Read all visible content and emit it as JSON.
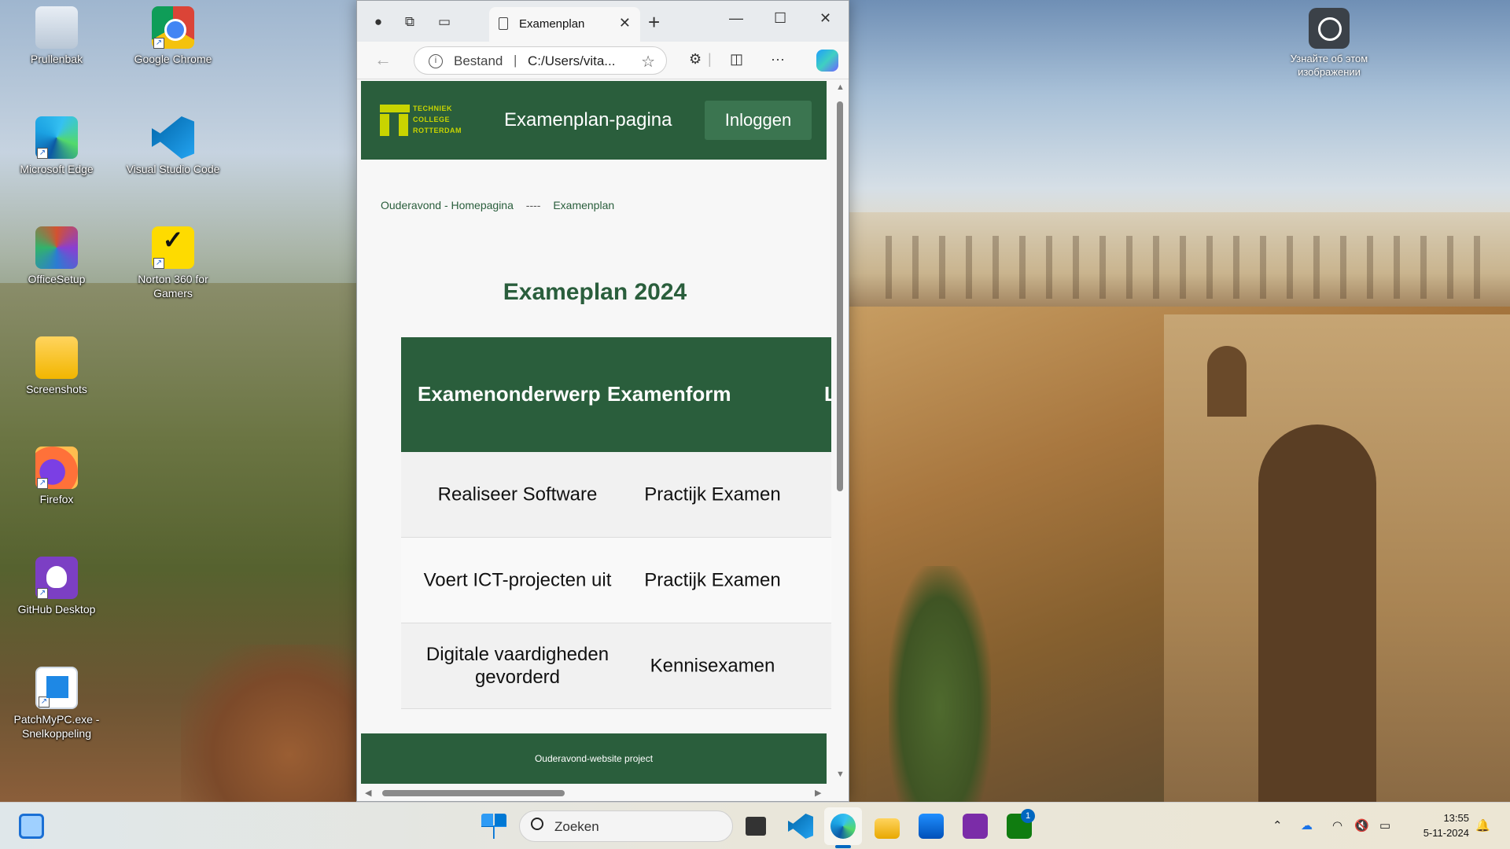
{
  "desktop": {
    "icons": [
      {
        "label": "Prullenbak"
      },
      {
        "label": "Google Chrome"
      },
      {
        "label": "Microsoft Edge"
      },
      {
        "label": "Visual Studio Code"
      },
      {
        "label": "OfficeSetup"
      },
      {
        "label": "Norton 360 for Gamers"
      },
      {
        "label": "Screenshots"
      },
      {
        "label": "Firefox"
      },
      {
        "label": "GitHub Desktop"
      },
      {
        "label": "PatchMyPC.exe - Snelkoppeling"
      }
    ],
    "learn_label": "Узнайте об этом изображении"
  },
  "browser": {
    "tab_title": "Examenplan",
    "address": {
      "protocol": "Bestand",
      "path": "C:/Users/vita..."
    },
    "page": {
      "brand_text": [
        "TECHNIEK",
        "COLLEGE",
        "ROTTERDAM"
      ],
      "site_title": "Examenplan-pagina",
      "login_label": "Inloggen",
      "breadcrumb": {
        "home": "Ouderavond - Homepagina",
        "sep": "----",
        "current": "Examenplan"
      },
      "heading": "Exameplan 2024",
      "table": {
        "headers": [
          "Examenonderwerp",
          "Examenform",
          "L"
        ],
        "rows": [
          {
            "onderwerp": "Realiseer Software",
            "vorm": "Practijk Examen"
          },
          {
            "onderwerp": "Voert ICT-projecten uit",
            "vorm": "Practijk Examen"
          },
          {
            "onderwerp": "Digitale vaardigheden gevorderd",
            "vorm": "Kennisexamen"
          }
        ]
      },
      "footer": "Ouderavond-website project"
    }
  },
  "taskbar": {
    "search_placeholder": "Zoeken",
    "xbox_badge": "1",
    "clock": {
      "time": "13:55",
      "date": "5-11-2024"
    }
  },
  "colors": {
    "brand_green": "#2a5e3c",
    "accent_lime": "#c8d400"
  }
}
